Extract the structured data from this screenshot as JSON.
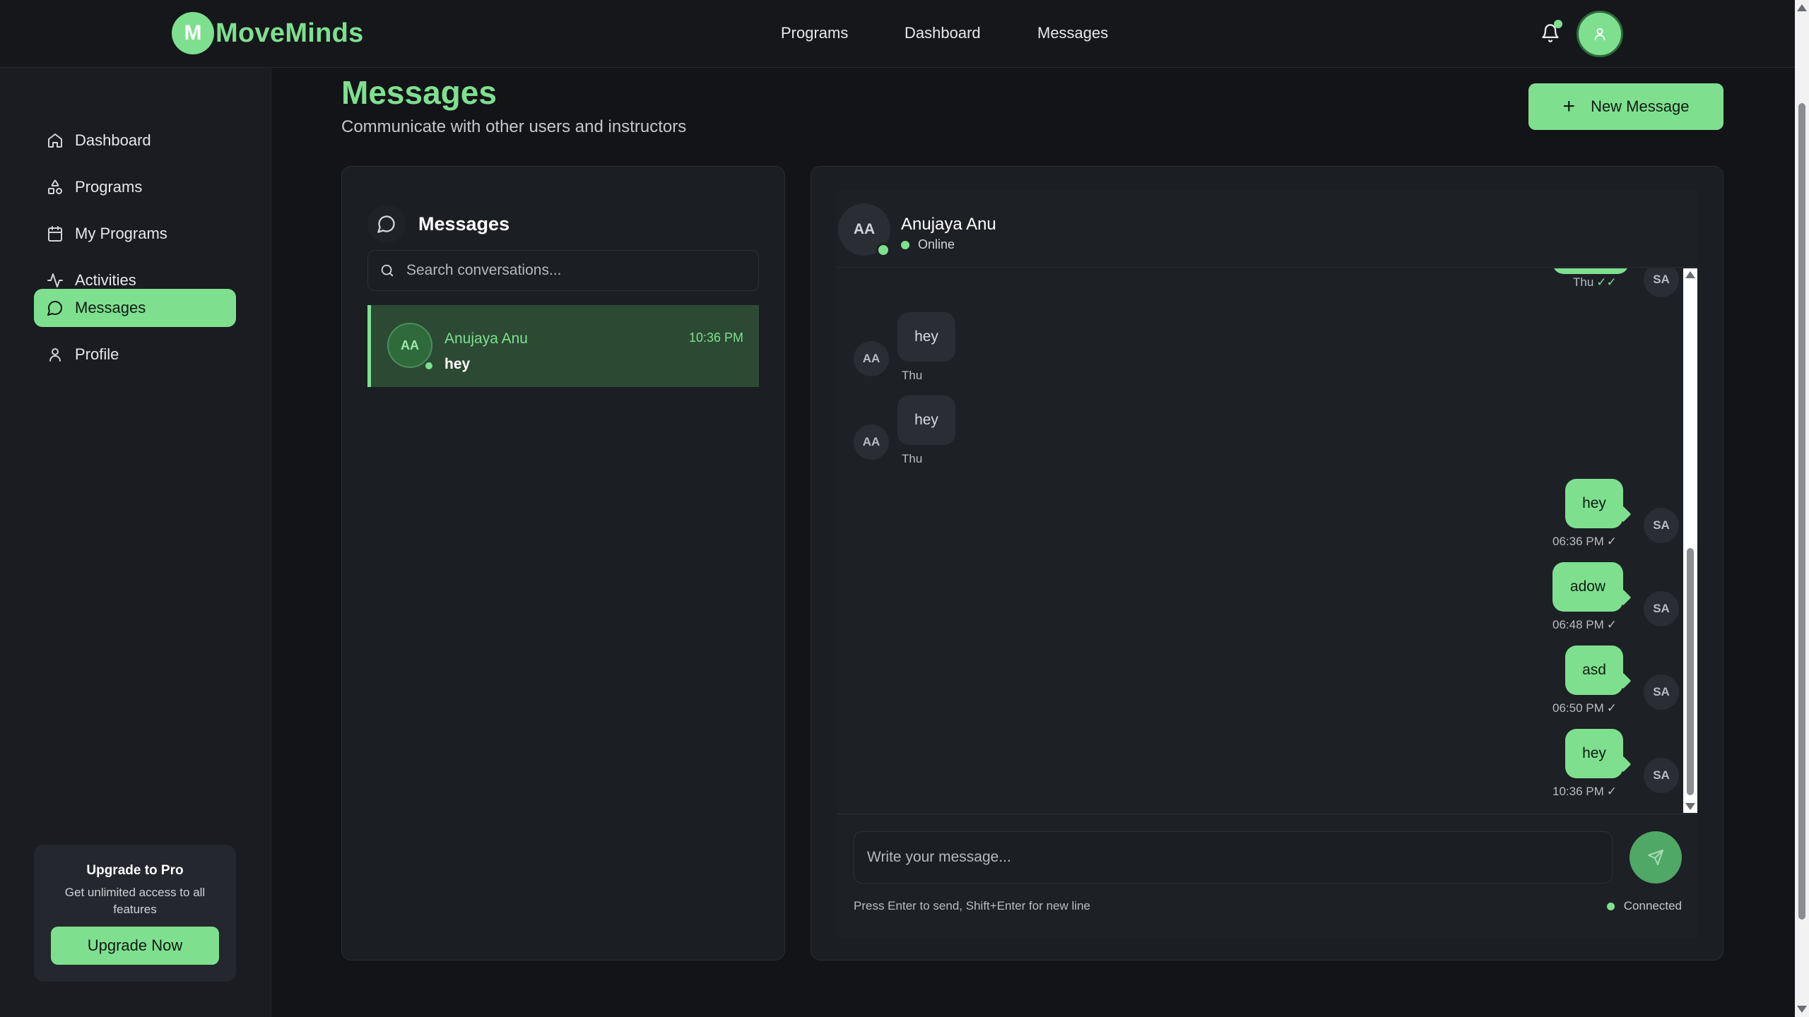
{
  "app": {
    "logo_letter": "M",
    "name": "MoveMinds",
    "accent_color": "#7ee08f"
  },
  "topnav": {
    "links": [
      "Programs",
      "Dashboard",
      "Messages"
    ],
    "notification_icon": "bell-icon",
    "user_icon": "user-icon"
  },
  "sidebar": {
    "items": [
      {
        "label": "Dashboard",
        "icon": "home-icon"
      },
      {
        "label": "Programs",
        "icon": "shapes-icon"
      },
      {
        "label": "My Programs",
        "icon": "calendar-icon"
      },
      {
        "label": "Activities",
        "icon": "activity-icon"
      },
      {
        "label": "Messages",
        "icon": "message-icon",
        "active": true
      },
      {
        "label": "Profile",
        "icon": "user-icon"
      }
    ],
    "upgrade": {
      "title": "Upgrade to Pro",
      "description": "Get unlimited access to all features",
      "button": "Upgrade Now"
    }
  },
  "page": {
    "title": "Messages",
    "subtitle": "Communicate with other users and instructors",
    "new_message_button": "New Message"
  },
  "conversations": {
    "title": "Messages",
    "search_placeholder": "Search conversations...",
    "items": [
      {
        "initials": "AA",
        "name": "Anujaya Anu",
        "time": "10:36 PM",
        "last_message": "hey",
        "online": true,
        "selected": true
      }
    ]
  },
  "chat": {
    "contact": {
      "initials": "AA",
      "name": "Anujaya Anu",
      "status": "Online"
    },
    "messages": [
      {
        "direction": "out",
        "text": "",
        "time": "Thu",
        "status": "read",
        "initials": "SA"
      },
      {
        "direction": "in",
        "text": "hey",
        "time": "Thu",
        "initials": "AA"
      },
      {
        "direction": "in",
        "text": "hey",
        "time": "Thu",
        "initials": "AA"
      },
      {
        "direction": "out",
        "text": "hey",
        "time": "06:36 PM",
        "status": "sent",
        "initials": "SA"
      },
      {
        "direction": "out",
        "text": "adow",
        "time": "06:48 PM",
        "status": "sent",
        "initials": "SA"
      },
      {
        "direction": "out",
        "text": "asd",
        "time": "06:50 PM",
        "status": "sent",
        "initials": "SA"
      },
      {
        "direction": "out",
        "text": "hey",
        "time": "10:36 PM",
        "status": "sent",
        "initials": "SA"
      }
    ],
    "compose_placeholder": "Write your message...",
    "hint": "Press Enter to send, Shift+Enter for new line",
    "connection_status": "Connected"
  }
}
